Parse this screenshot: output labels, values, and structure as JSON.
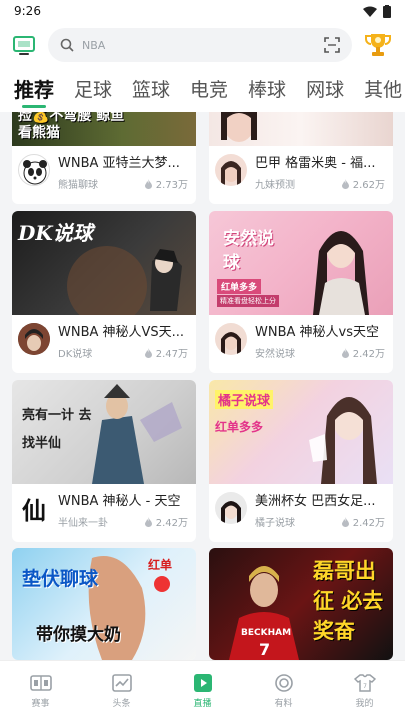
{
  "status": {
    "time": "9:26"
  },
  "search": {
    "placeholder": "NBA"
  },
  "tabs": [
    {
      "label": "推荐",
      "active": true
    },
    {
      "label": "足球"
    },
    {
      "label": "篮球"
    },
    {
      "label": "电竞"
    },
    {
      "label": "棒球"
    },
    {
      "label": "网球"
    },
    {
      "label": "其他"
    }
  ],
  "cards": [
    {
      "thumb_text": "捡💰不弯腰 鲸鱼看熊猫",
      "title": "WNBA 亚特兰大梦...",
      "author": "熊猫聊球",
      "heat": "2.73万"
    },
    {
      "thumb_text": "",
      "title": "巴甲 格雷米奥 - 福...",
      "author": "九妹预测",
      "heat": "2.62万"
    },
    {
      "thumb_text": "DK说球",
      "title": "WNBA 神秘人VS天...",
      "author": "DK说球",
      "heat": "2.47万"
    },
    {
      "thumb_text": "安然说球",
      "thumb_sub": "红单多多",
      "thumb_note": "精准看盘轻松上分",
      "title": "WNBA 神秘人vs天空",
      "author": "安然说球",
      "heat": "2.42万"
    },
    {
      "thumb_text": "亮有一计 去找半仙",
      "title": "WNBA 神秘人 - 天空",
      "author": "半仙来一卦",
      "heat": "2.42万",
      "avatar_text": "仙"
    },
    {
      "thumb_text": "橘子说球",
      "thumb_sub": "红单多多",
      "title": "美洲杯女 巴西女足...",
      "author": "橘子说球",
      "heat": "2.42万"
    },
    {
      "thumb_text": "垫伏聊球",
      "thumb_sub": "带你摸大奶",
      "thumb_note": "红单",
      "title": "",
      "author": "",
      "heat": ""
    },
    {
      "thumb_text": "磊哥出征 必去奖奋",
      "thumb_sub": "BECKHAM",
      "thumb_note": "7",
      "title": "",
      "author": "",
      "heat": ""
    }
  ],
  "nav": [
    {
      "label": "赛事",
      "icon": "scoreboard-icon"
    },
    {
      "label": "头条",
      "icon": "chart-icon"
    },
    {
      "label": "直播",
      "icon": "play-icon",
      "active": true
    },
    {
      "label": "有料",
      "icon": "target-icon"
    },
    {
      "label": "我的",
      "icon": "jersey-icon"
    }
  ],
  "colors": {
    "accent": "#2bb673"
  }
}
